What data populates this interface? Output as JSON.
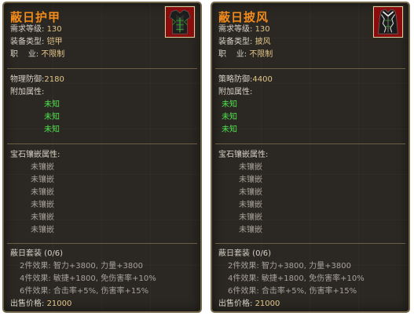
{
  "cards": [
    {
      "title": "蔽日护甲",
      "icon": "armor-icon",
      "req_label": "需求等级:",
      "req_value": "130",
      "type_label": "装备类型:",
      "type_value": "铠甲",
      "job_label": "职    业:",
      "job_value": "不限制",
      "defense_label": "物理防御:",
      "defense_value": "2180",
      "extra_label": "附加属性:",
      "extra_values": [
        "未知",
        "未知",
        "未知"
      ],
      "gem_label": "宝石镶嵌属性:",
      "gem_slots": [
        "未镶嵌",
        "未镶嵌",
        "未镶嵌",
        "未镶嵌",
        "未镶嵌",
        "未镶嵌"
      ],
      "set_label": "蔽日套装 (0/6)",
      "set_effects": [
        {
          "label": "2件效果:",
          "value": "智力+3800, 力量+3800"
        },
        {
          "label": "4件效果:",
          "value": "敏捷+1800, 免伤害率+10%"
        },
        {
          "label": "6件效果:",
          "value": "合击率+5%, 伤害率+15%"
        }
      ],
      "price_label": "出售价格:",
      "price_value": "21000"
    },
    {
      "title": "蔽日披风",
      "icon": "cloak-icon",
      "req_label": "需求等级:",
      "req_value": "130",
      "type_label": "装备类型:",
      "type_value": "披风",
      "job_label": "职    业:",
      "job_value": "不限制",
      "defense_label": "策略防御:",
      "defense_value": "4400",
      "extra_label": "附加属性:",
      "extra_values": [
        "未知",
        "未知",
        "未知"
      ],
      "gem_label": "宝石镶嵌属性:",
      "gem_slots": [
        "未镶嵌",
        "未镶嵌",
        "未镶嵌",
        "未镶嵌",
        "未镶嵌",
        "未镶嵌"
      ],
      "set_label": "蔽日套装 (0/6)",
      "set_effects": [
        {
          "label": "2件效果:",
          "value": "智力+3800, 力量+3800"
        },
        {
          "label": "4件效果:",
          "value": "敏捷+1800, 免伤害率+10%"
        },
        {
          "label": "6件效果:",
          "value": "合击率+5%, 伤害率+15%"
        }
      ],
      "price_label": "出售价格:",
      "price_value": "21000"
    }
  ]
}
